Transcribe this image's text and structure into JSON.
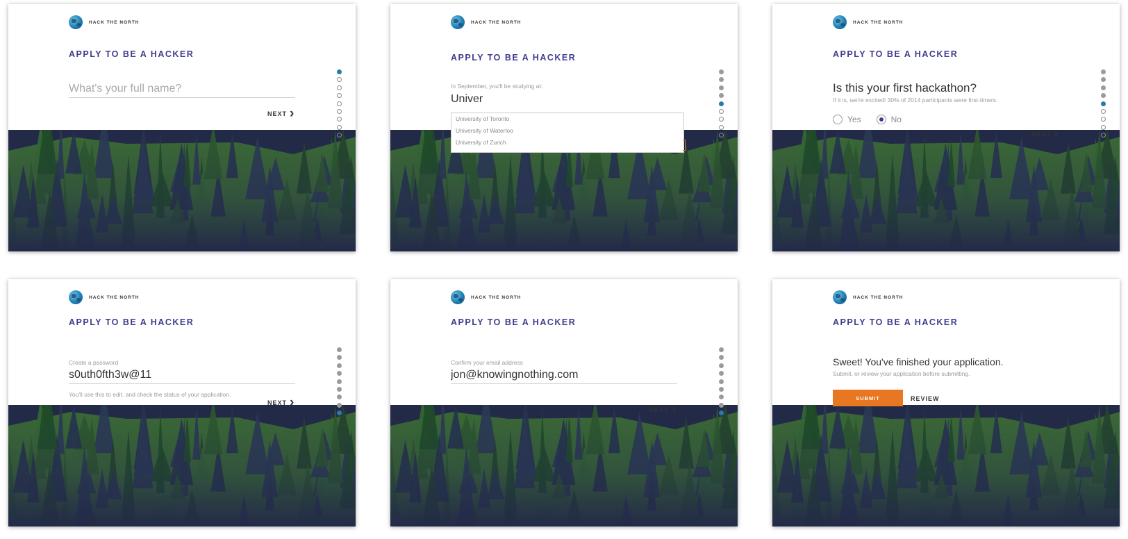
{
  "brand": "HACK THE NORTH",
  "page_title": "APPLY TO BE A HACKER",
  "next_label": "NEXT",
  "screens": [
    {
      "placeholder": "What's your full name?",
      "value": ""
    },
    {
      "label": "In September, you'll be studying at:",
      "value": "Univer",
      "suggestions": [
        "University of Toronto",
        "University of Waterloo",
        "University of Zurich"
      ]
    },
    {
      "question": "Is this your first hackathon?",
      "hint": "If it is, we're excited! 30% of 2014 participants were first-timers.",
      "options": [
        "Yes",
        "No"
      ],
      "selected": "No"
    },
    {
      "label": "Create a password",
      "value": "s0uth0fth3w@11",
      "hint": "You'll use this to edit, and check the status of your application."
    },
    {
      "label": "Confirm your email address",
      "value": "jon@knowingnothing.com"
    },
    {
      "heading": "Sweet! You've finished your application.",
      "hint": "Submit, or review your application before submitting.",
      "submit_label": "SUBMIT",
      "review_label": "REVIEW"
    }
  ],
  "progress": [
    {
      "active": 1,
      "done": 0
    },
    {
      "active": 5,
      "done": 4
    },
    {
      "active": 5,
      "done": 4
    },
    {
      "active": 9,
      "done": 8
    },
    {
      "active": 9,
      "done": 8
    },
    {
      "active": null,
      "done": 0
    }
  ],
  "colors": {
    "accent": "#3f3c8f",
    "progress_active": "#2b7aa8",
    "submit": "#e87722",
    "forest_dark": "#232a48",
    "hill": "#3b6a35"
  }
}
